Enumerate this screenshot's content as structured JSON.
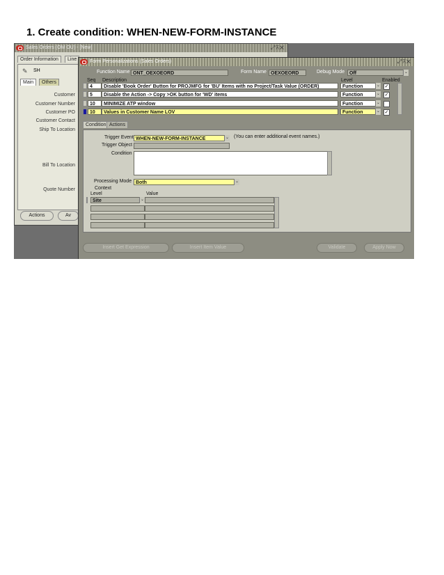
{
  "heading": "1.  Create condition:  WHEN-NEW-FORM-INSTANCE",
  "back_window": {
    "title": "Sales Orders (OM OU) - [New]",
    "tabs": [
      "Order Information",
      "Line"
    ],
    "order_type": "SH",
    "subtabs": [
      "Main",
      "Others"
    ],
    "labels": [
      "Customer",
      "Customer Number",
      "Customer PO",
      "Customer Contact",
      "Ship To Location",
      "Bill To Location",
      "Quote Number"
    ],
    "actions_button": "Actions",
    "other_button": "Av"
  },
  "front_window": {
    "title": "Form Personalizations (Sales Orders)",
    "function_name_label": "Function Name",
    "function_name_value": "ONT_OEXOEORD",
    "form_name_label": "Form Name",
    "form_name_value": "OEXOEORD",
    "debug_mode_label": "Debug Mode",
    "debug_mode_value": "Off",
    "columns": {
      "seq": "Seq",
      "description": "Description",
      "level": "Level",
      "enabled": "Enabled"
    },
    "rules": [
      {
        "seq": "4",
        "description": "Disable 'Book Order' Button for PROJMFG for 'BU' Items with no Project/Task Value (ORDER)",
        "level": "Function",
        "enabled": "✓"
      },
      {
        "seq": "5",
        "description": "Disable the Action -> Copy >OK button for 'WD' items",
        "level": "Function",
        "enabled": "✓"
      },
      {
        "seq": "10",
        "description": "MINIMIZE ATP window",
        "level": "Function",
        "enabled": ""
      },
      {
        "seq": "10",
        "description": "Values in Customer Name LOV",
        "level": "Function",
        "enabled": "✓"
      }
    ],
    "tabs": [
      "Condition",
      "Actions"
    ],
    "trigger_event_label": "Trigger Event",
    "trigger_event_value": "WHEN-NEW-FORM-INSTANCE",
    "trigger_hint": "(You can enter additional event names.)",
    "trigger_object_label": "Trigger Object",
    "condition_label": "Condition",
    "processing_mode_label": "Processing Mode",
    "processing_mode_value": "Both",
    "context_label": "Context",
    "context_level_header": "Level",
    "context_value_header": "Value",
    "context_level_value": "Site",
    "buttons": [
      "Insert Get Expression",
      "Insert Item Value",
      "Validate",
      "Apply Now"
    ]
  }
}
